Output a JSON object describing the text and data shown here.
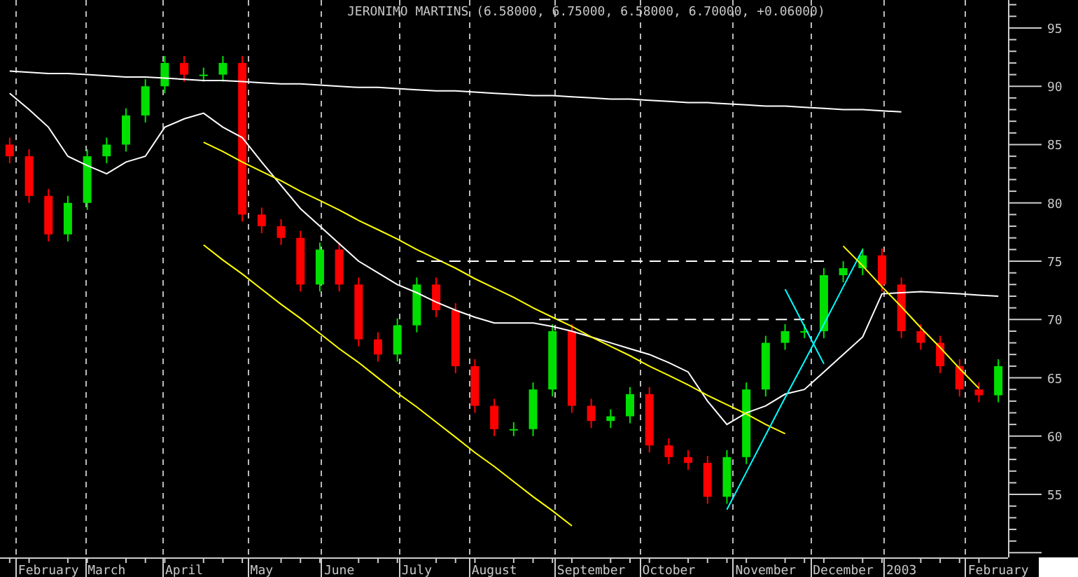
{
  "chart": {
    "chart_data": {
      "type": "candlestick",
      "title": "JERONIMO MARTINS (6.58000, 6.75000, 6.58000, 6.70000, +0.06000)",
      "ylim": [
        49.6,
        97.4
      ],
      "yticks": [
        55,
        60,
        65,
        70,
        75,
        80,
        85,
        90,
        95
      ],
      "grid": true,
      "categories": [
        null,
        null,
        "February",
        null,
        null,
        "March",
        null,
        null,
        null,
        "April",
        null,
        null,
        null,
        "May",
        null,
        null,
        null,
        "June",
        null,
        null,
        null,
        "July",
        null,
        null,
        null,
        "August",
        null,
        null,
        null,
        null,
        "September",
        null,
        null,
        null,
        "October",
        null,
        null,
        null,
        null,
        "November",
        null,
        null,
        null,
        "December",
        null,
        null,
        "2003",
        null,
        null,
        null,
        null,
        "February"
      ],
      "ohlc": [
        [
          85.0,
          85.6,
          83.4,
          84.0
        ],
        [
          84.0,
          84.6,
          80.0,
          80.6
        ],
        [
          80.6,
          81.2,
          76.7,
          77.3
        ],
        [
          77.3,
          80.6,
          76.7,
          80.0
        ],
        [
          80.0,
          84.6,
          79.4,
          84.0
        ],
        [
          84.0,
          85.6,
          83.4,
          85.0
        ],
        [
          85.0,
          88.1,
          84.4,
          87.5
        ],
        [
          87.5,
          90.6,
          86.9,
          90.0
        ],
        [
          90.0,
          92.6,
          89.4,
          92.0
        ],
        [
          92.0,
          92.6,
          90.4,
          91.0
        ],
        [
          91.0,
          91.6,
          90.4,
          91.0
        ],
        [
          91.0,
          92.6,
          90.4,
          92.0
        ],
        [
          92.0,
          92.6,
          78.4,
          79.0
        ],
        [
          79.0,
          79.6,
          77.4,
          78.0
        ],
        [
          78.0,
          78.6,
          76.4,
          77.0
        ],
        [
          77.0,
          77.6,
          72.4,
          73.0
        ],
        [
          73.0,
          76.6,
          72.4,
          76.0
        ],
        [
          76.0,
          76.6,
          72.4,
          73.0
        ],
        [
          73.0,
          73.6,
          67.7,
          68.3
        ],
        [
          68.3,
          68.9,
          66.4,
          67.0
        ],
        [
          67.0,
          70.1,
          66.4,
          69.5
        ],
        [
          69.5,
          73.6,
          68.9,
          73.0
        ],
        [
          73.0,
          73.6,
          70.2,
          70.8
        ],
        [
          70.8,
          71.4,
          65.4,
          66.0
        ],
        [
          66.0,
          66.6,
          62.0,
          62.6
        ],
        [
          62.6,
          63.2,
          60.0,
          60.6
        ],
        [
          60.6,
          61.2,
          60.0,
          60.6
        ],
        [
          60.6,
          64.6,
          60.0,
          64.0
        ],
        [
          64.0,
          69.6,
          63.4,
          69.0
        ],
        [
          69.0,
          69.6,
          62.0,
          62.6
        ],
        [
          62.6,
          63.2,
          60.7,
          61.3
        ],
        [
          61.3,
          62.3,
          60.7,
          61.7
        ],
        [
          61.7,
          64.2,
          61.1,
          63.6
        ],
        [
          63.6,
          64.2,
          58.6,
          59.2
        ],
        [
          59.2,
          59.8,
          57.6,
          58.2
        ],
        [
          58.2,
          58.8,
          57.1,
          57.7
        ],
        [
          57.7,
          58.3,
          54.2,
          54.8
        ],
        [
          54.8,
          58.8,
          54.2,
          58.2
        ],
        [
          58.2,
          64.6,
          57.6,
          64.0
        ],
        [
          64.0,
          68.6,
          63.4,
          68.0
        ],
        [
          68.0,
          69.6,
          67.4,
          69.0
        ],
        [
          69.0,
          69.6,
          68.4,
          69.0
        ],
        [
          69.0,
          74.4,
          68.4,
          73.8
        ],
        [
          73.8,
          75.0,
          73.2,
          74.4
        ],
        [
          74.4,
          76.1,
          73.8,
          75.5
        ],
        [
          75.5,
          76.1,
          72.4,
          73.0
        ],
        [
          73.0,
          73.6,
          68.4,
          69.0
        ],
        [
          69.0,
          69.6,
          67.4,
          68.0
        ],
        [
          68.0,
          68.6,
          65.4,
          66.0
        ],
        [
          66.0,
          66.6,
          63.4,
          64.0
        ],
        [
          64.0,
          64.6,
          62.9,
          63.5
        ],
        [
          63.5,
          66.6,
          62.9,
          66.0
        ]
      ],
      "series": [
        {
          "type": "line",
          "color": "#ffffff",
          "values": [
            89.4,
            88.0,
            86.5,
            84.0,
            83.2,
            82.5,
            83.5,
            84.0,
            86.5,
            87.2,
            87.7,
            86.5,
            85.6,
            83.5,
            81.5,
            79.5,
            78.0,
            76.5,
            75.0,
            74.0,
            73.0,
            72.3,
            71.5,
            70.8,
            70.2,
            69.7,
            69.7,
            69.7,
            69.4,
            69.0,
            68.5,
            68.0,
            67.5,
            67.0,
            66.3,
            65.5,
            63.0,
            61.0,
            62.0,
            62.6,
            63.6,
            64.0,
            65.5,
            67.0,
            68.5,
            72.2,
            72.3,
            72.4,
            72.3,
            72.2,
            72.1,
            72.0
          ]
        },
        {
          "type": "line",
          "color": "#ffffff",
          "values": [
            91.3,
            91.2,
            91.1,
            91.1,
            91.0,
            90.9,
            90.8,
            90.8,
            90.7,
            90.6,
            90.5,
            90.5,
            90.4,
            90.3,
            90.2,
            90.2,
            90.1,
            90.0,
            89.9,
            89.9,
            89.8,
            89.7,
            89.6,
            89.6,
            89.5,
            89.4,
            89.3,
            89.2,
            89.2,
            89.1,
            89.0,
            88.9,
            88.9,
            88.8,
            88.7,
            88.6,
            88.6,
            88.5,
            88.4,
            88.3,
            88.3,
            88.2,
            88.1,
            88.0,
            88.0,
            87.9,
            87.8,
            null,
            null,
            null,
            null,
            null
          ]
        },
        {
          "type": "line",
          "color": "#ffff00",
          "values": [
            null,
            null,
            null,
            null,
            null,
            null,
            null,
            null,
            null,
            null,
            85.2,
            84.4,
            83.5,
            82.7,
            81.9,
            81.0,
            80.2,
            79.4,
            78.5,
            77.7,
            76.9,
            76.0,
            75.2,
            74.4,
            73.5,
            72.7,
            71.9,
            71.0,
            70.2,
            69.4,
            68.5,
            67.7,
            66.9,
            66.0,
            65.2,
            64.4,
            63.5,
            62.7,
            61.9,
            61.0,
            60.2,
            null,
            null,
            null,
            null,
            null,
            null,
            null,
            null,
            null,
            null,
            null
          ]
        },
        {
          "type": "line",
          "color": "#ffff00",
          "values": [
            null,
            null,
            null,
            null,
            null,
            null,
            null,
            null,
            null,
            null,
            76.4,
            75.1,
            73.9,
            72.6,
            71.3,
            70.1,
            68.8,
            67.5,
            66.3,
            65.0,
            63.7,
            62.5,
            61.2,
            59.9,
            58.6,
            57.4,
            56.1,
            54.8,
            53.6,
            52.3,
            null,
            null,
            null,
            null,
            null,
            null,
            null,
            null,
            null,
            null,
            null,
            null,
            null,
            null,
            null,
            null,
            null,
            null,
            null,
            null,
            null,
            null
          ]
        },
        {
          "type": "line",
          "color": "#ffffff",
          "line_style": "dashed",
          "values": [
            null,
            null,
            null,
            null,
            null,
            null,
            null,
            null,
            null,
            null,
            null,
            null,
            null,
            null,
            null,
            null,
            null,
            null,
            null,
            null,
            null,
            75.0,
            75.0,
            75.0,
            75.0,
            75.0,
            75.0,
            75.0,
            75.0,
            75.0,
            75.0,
            75.0,
            75.0,
            75.0,
            75.0,
            75.0,
            75.0,
            75.0,
            75.0,
            75.0,
            75.0,
            75.0,
            75.0,
            null,
            null,
            null,
            null,
            null,
            null,
            null,
            null,
            null
          ]
        },
        {
          "type": "line",
          "color": "#ffffff",
          "line_style": "dashed",
          "values": [
            null,
            null,
            null,
            null,
            null,
            null,
            null,
            null,
            null,
            null,
            null,
            null,
            null,
            null,
            null,
            null,
            null,
            null,
            null,
            null,
            null,
            null,
            null,
            null,
            null,
            null,
            null,
            70.0,
            70.0,
            70.0,
            70.0,
            70.0,
            70.0,
            70.0,
            70.0,
            70.0,
            70.0,
            70.0,
            70.0,
            70.0,
            70.0,
            70.0,
            null,
            null,
            null,
            null,
            null,
            null,
            null,
            null,
            null,
            null
          ]
        },
        {
          "type": "line",
          "color": "#00ffff",
          "values": [
            null,
            null,
            null,
            null,
            null,
            null,
            null,
            null,
            null,
            null,
            null,
            null,
            null,
            null,
            null,
            null,
            null,
            null,
            null,
            null,
            null,
            null,
            null,
            null,
            null,
            null,
            null,
            null,
            null,
            null,
            null,
            null,
            null,
            null,
            null,
            null,
            null,
            53.7,
            56.9,
            60.1,
            63.3,
            66.4,
            69.6,
            72.8,
            76.0,
            null,
            null,
            null,
            null,
            null,
            null,
            null
          ]
        },
        {
          "type": "line",
          "color": "#00ffff",
          "values": [
            null,
            null,
            null,
            null,
            null,
            null,
            null,
            null,
            null,
            null,
            null,
            null,
            null,
            null,
            null,
            null,
            null,
            null,
            null,
            null,
            null,
            null,
            null,
            null,
            null,
            null,
            null,
            null,
            null,
            null,
            null,
            null,
            null,
            null,
            null,
            null,
            null,
            null,
            null,
            null,
            72.6,
            69.4,
            66.2,
            null,
            null,
            null,
            null,
            null,
            null,
            null,
            null,
            null
          ]
        },
        {
          "type": "line",
          "color": "#ffff00",
          "values": [
            null,
            null,
            null,
            null,
            null,
            null,
            null,
            null,
            null,
            null,
            null,
            null,
            null,
            null,
            null,
            null,
            null,
            null,
            null,
            null,
            null,
            null,
            null,
            null,
            null,
            null,
            null,
            null,
            null,
            null,
            null,
            null,
            null,
            null,
            null,
            null,
            null,
            null,
            null,
            null,
            null,
            null,
            null,
            76.3,
            74.6,
            72.8,
            71.1,
            69.3,
            67.6,
            65.8,
            64.1,
            null
          ]
        }
      ]
    }
  }
}
